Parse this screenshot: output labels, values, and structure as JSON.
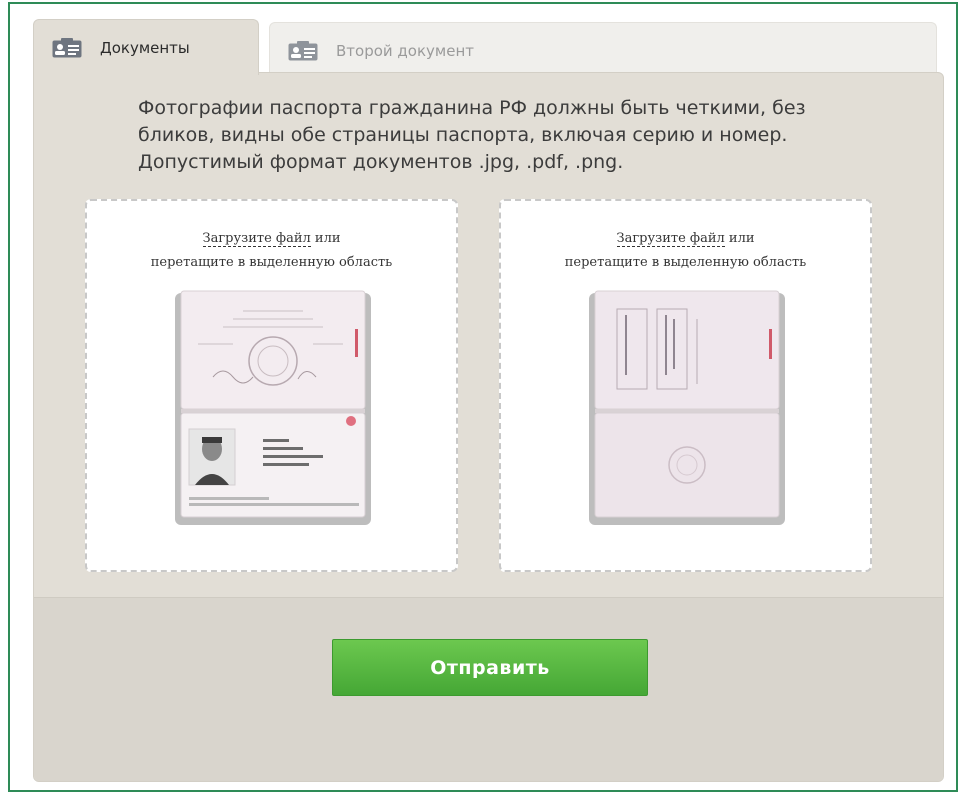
{
  "tabs": [
    {
      "label": "Документы",
      "icon": "id-card-icon",
      "active": true
    },
    {
      "label": "Второй документ",
      "icon": "id-card-icon",
      "active": false
    }
  ],
  "instructions": "Фотографии паспорта гражданина РФ должны быть четкими, без бликов, видны обе страницы паспорта, включая серию и номер. Допустимый формат документов .jpg, .pdf, .png.",
  "uploads": [
    {
      "link": "Загрузите файл",
      "tail": " или",
      "line2": "перетащите в выделенную область",
      "image": "passport-main-page"
    },
    {
      "link": "Загрузите файл",
      "tail": " или",
      "line2": "перетащите в выделенную область",
      "image": "passport-registration-page"
    }
  ],
  "submit_label": "Отправить",
  "colors": {
    "accent_green": "#4fb63c",
    "frame_green": "#2e8b57",
    "panel": "#e2ded6"
  }
}
